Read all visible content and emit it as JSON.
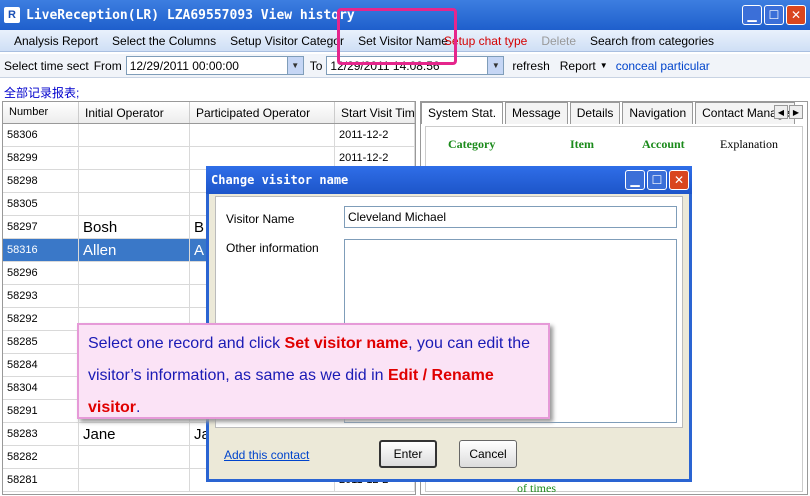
{
  "window": {
    "title": "LiveReception(LR) LZA69557093  View history",
    "icon_label": "R",
    "minimize": "▁",
    "maximize": "☐",
    "close": "✕"
  },
  "menu": {
    "items": [
      "Analysis Report",
      "Select the Columns",
      "Setup Visitor Categories",
      "Set Visitor Name",
      "Setup chat type",
      "Delete",
      "Search from categories"
    ]
  },
  "filter": {
    "time_label": "Select time sect",
    "from_label": "From",
    "from_value": "12/29/2011 00:00:00",
    "to_label": "To",
    "to_value": "12/29/2011 14:08:56",
    "refresh": "refresh",
    "report": "Report",
    "conceal": "conceal particular"
  },
  "report_header": "全部记录报表;",
  "table": {
    "columns": [
      "Number",
      "Initial Operator",
      "Participated Operator",
      "Start Visit Time"
    ],
    "rows": [
      {
        "num": "58306",
        "init": "",
        "part": "",
        "start": "2011-12-2"
      },
      {
        "num": "58299",
        "init": "",
        "part": "",
        "start": "2011-12-2"
      },
      {
        "num": "58298",
        "init": "",
        "part": "",
        "start": ""
      },
      {
        "num": "58305",
        "init": "",
        "part": "",
        "start": ""
      },
      {
        "num": "58297",
        "init": "Bosh",
        "part": "B",
        "start": ""
      },
      {
        "num": "58316",
        "init": "Allen",
        "part": "A",
        "start": ""
      },
      {
        "num": "58296",
        "init": "",
        "part": "",
        "start": ""
      },
      {
        "num": "58293",
        "init": "",
        "part": "",
        "start": ""
      },
      {
        "num": "58292",
        "init": "",
        "part": "",
        "start": ""
      },
      {
        "num": "58285",
        "init": "",
        "part": "",
        "start": ""
      },
      {
        "num": "58284",
        "init": "",
        "part": "",
        "start": ""
      },
      {
        "num": "58304",
        "init": "",
        "part": "",
        "start": ""
      },
      {
        "num": "58291",
        "init": "",
        "part": "",
        "start": ""
      },
      {
        "num": "58283",
        "init": "Jane",
        "part": "Ja",
        "start": ""
      },
      {
        "num": "58282",
        "init": "",
        "part": "",
        "start": ""
      },
      {
        "num": "58281",
        "init": "",
        "part": "",
        "start": "2011-12-2"
      }
    ]
  },
  "tabs": [
    "System Stat.",
    "Message",
    "Details",
    "Navigation",
    "Contact Manager"
  ],
  "stats": {
    "columns": [
      "Category",
      "Item",
      "Account",
      "Explanation"
    ],
    "footer_text": "of times"
  },
  "dialog": {
    "title": "Change visitor name",
    "name_label": "Visitor Name",
    "name_value": "Cleveland Michael",
    "other_label": "Other information",
    "other_value": "",
    "add_contact": "Add this contact",
    "enter": "Enter",
    "cancel": "Cancel"
  },
  "callout": {
    "p1": "Select one record and click ",
    "h1": "Set visitor name",
    "p2": ", you can edit the visitor’s information, as same as we did in ",
    "h2": "Edit / Rename visitor",
    "p3": "."
  }
}
